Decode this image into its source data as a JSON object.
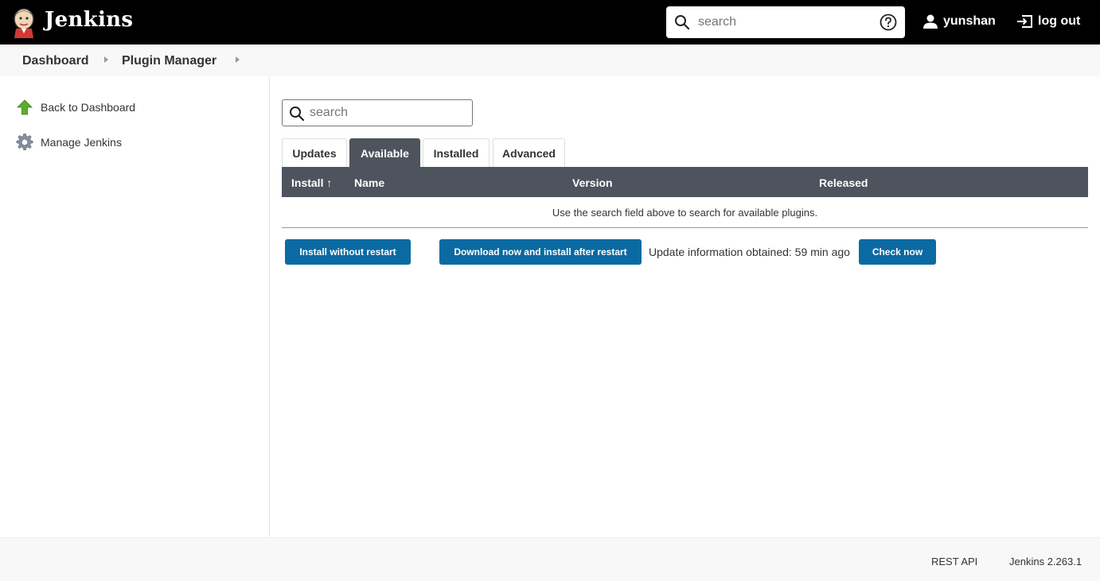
{
  "header": {
    "app_name": "Jenkins",
    "search_placeholder": "search",
    "user_name": "yunshan",
    "logout_label": "log out"
  },
  "breadcrumb": {
    "items": [
      "Dashboard",
      "Plugin Manager"
    ]
  },
  "sidebar": {
    "items": [
      {
        "label": "Back to Dashboard",
        "icon": "up-arrow-icon"
      },
      {
        "label": "Manage Jenkins",
        "icon": "gear-icon"
      }
    ]
  },
  "main": {
    "search_placeholder": "search",
    "tabs": [
      {
        "label": "Updates",
        "active": false
      },
      {
        "label": "Available",
        "active": true
      },
      {
        "label": "Installed",
        "active": false
      },
      {
        "label": "Advanced",
        "active": false
      }
    ],
    "table": {
      "columns": [
        "Install ↑",
        "Name",
        "Version",
        "Released"
      ],
      "empty_message": "Use the search field above to search for available plugins."
    },
    "buttons": {
      "install_without_restart": "Install without restart",
      "download_install_after_restart": "Download now and install after restart",
      "check_now": "Check now"
    },
    "update_info": "Update information obtained: 59 min ago"
  },
  "footer": {
    "rest_api": "REST API",
    "version": "Jenkins 2.263.1"
  },
  "colors": {
    "header_bg": "#000000",
    "accent_button": "#0b6aa2",
    "table_header": "#4d545d",
    "breadcrumb_bg": "#f8f8f8"
  }
}
